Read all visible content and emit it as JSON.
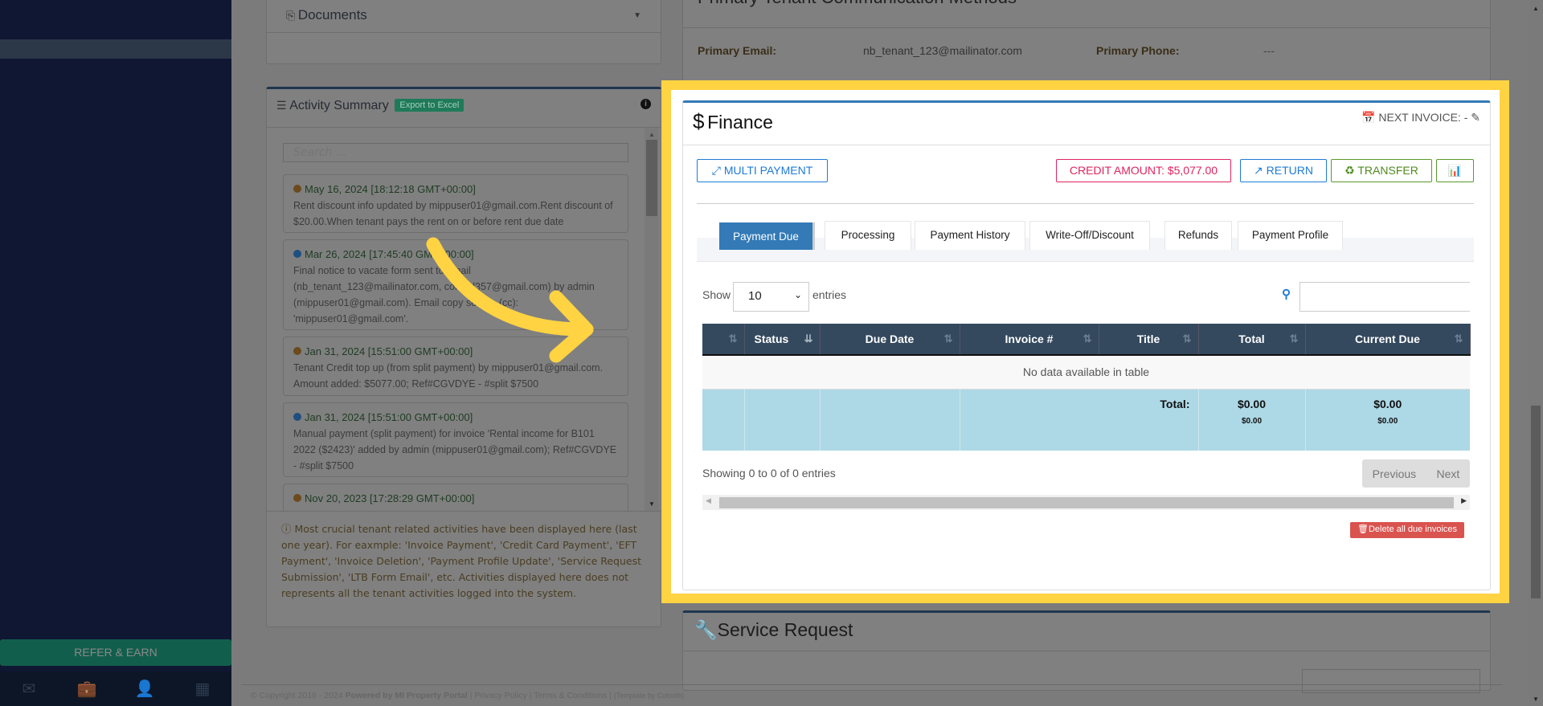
{
  "sidebar": {
    "refer_label": "REFER & EARN",
    "bottom_icons": [
      "envelope-icon",
      "briefcase-icon",
      "user-icon",
      "calculator-icon"
    ]
  },
  "documents": {
    "title": "Documents"
  },
  "activity": {
    "title": "Activity Summary",
    "export_label": "Export to Excel",
    "search_placeholder": "Search ...",
    "items": [
      {
        "date": "May 16, 2024 [18:12:18 GMT+00:00]",
        "text": "Rent discount info updated by mippuser01@gmail.com.Rent discount of $20.00.When tenant pays the rent on or before rent due date",
        "dot": "#6b4a1c"
      },
      {
        "date": "Mar 26, 2024 [17:45:40 GMT+00:00]",
        "text": "Final notice to vacate form sent to email (nb_tenant_123@mailinator.com, conrad357@gmail.com) by admin (mippuser01@gmail.com). Email copy sent to (cc): 'mippuser01@gmail.com'.",
        "dot": "#1f4f7f"
      },
      {
        "date": "Jan 31, 2024 [15:51:00 GMT+00:00]",
        "text": "Tenant Credit top up (from split payment) by mippuser01@gmail.com. Amount added: $5077.00; Ref#CGVDYE - #split $7500",
        "dot": "#6b4a1c"
      },
      {
        "date": "Jan 31, 2024 [15:51:00 GMT+00:00]",
        "text": "Manual payment (split payment) for invoice 'Rental income for B101 2022 ($2423)' added by admin (mippuser01@gmail.com); Ref#CGVDYE - #split $7500",
        "dot": "#1f4f7f"
      },
      {
        "date": "Nov 20, 2023 [17:28:29 GMT+00:00]",
        "text": "",
        "dot": "#6b4a1c"
      }
    ],
    "note": "Most crucial tenant related activities have been displayed here (last one year). For eaxmple: 'Invoice Payment', 'Credit Card Payment', 'EFT Payment', 'Invoice Deletion', 'Payment Profile Update', 'Service Request Submission', 'LTB Form Email', etc. Activities displayed here does not represents all the tenant activities logged into the system."
  },
  "comm": {
    "title": "Primary Tenant Communication Methods",
    "email_label": "Primary Email:",
    "email_value": "nb_tenant_123@mailinator.com",
    "phone_label": "Primary Phone:",
    "phone_value": "---"
  },
  "finance": {
    "title": "Finance",
    "next_invoice": "NEXT INVOICE: -",
    "multi_payment": "MULTI PAYMENT",
    "credit_amount": "CREDIT AMOUNT: $5,077.00",
    "return": "RETURN",
    "transfer": "TRANSFER",
    "tabs": [
      "Payment Due",
      "Processing",
      "Payment History",
      "Write-Off/Discount",
      "Refunds",
      "Payment Profile"
    ],
    "active_tab": "Payment Due",
    "show_label": "Show",
    "entries_label": "entries",
    "page_length": "10",
    "columns": [
      "",
      "Status",
      "Due Date",
      "Invoice #",
      "Title",
      "Total",
      "Current Due"
    ],
    "empty_message": "No data available in table",
    "total_label": "Total:",
    "total_value": "$0.00",
    "total_sub": "$0.00",
    "current_due_value": "$0.00",
    "current_due_sub": "$0.00",
    "info": "Showing 0 to 0 of 0 entries",
    "previous": "Previous",
    "next": "Next",
    "delete_all": "Delete all due invoices",
    "colors": {
      "accent": "#337ab7",
      "credit": "#e0245e",
      "transfer": "#5a9a2a",
      "header": "#34495e",
      "total_row": "#add8e6",
      "delete": "#d9534f"
    }
  },
  "service_request": {
    "title": "Service Request"
  },
  "footer": {
    "copyright": "© Copyright 2016 - 2024",
    "powered": "Powered by MI Property Portal",
    "privacy": "Privacy Policy",
    "terms": "Terms & Conditions",
    "template": "(Template by Colorlib)"
  }
}
